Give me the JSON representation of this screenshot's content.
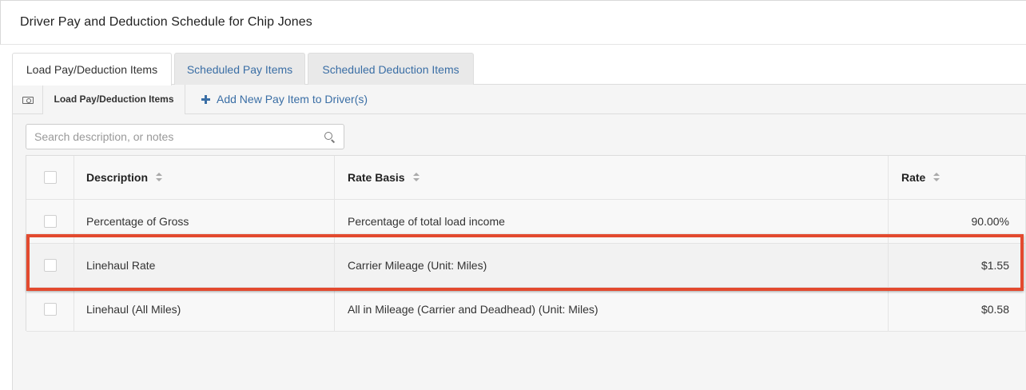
{
  "modal": {
    "title": "Driver Pay and Deduction Schedule for Chip Jones"
  },
  "tabs": [
    {
      "label": "Load Pay/Deduction Items",
      "active": true
    },
    {
      "label": "Scheduled Pay Items",
      "active": false
    },
    {
      "label": "Scheduled Deduction Items",
      "active": false
    }
  ],
  "toolbar": {
    "icon": "money-icon",
    "section_label": "Load Pay/Deduction Items",
    "add_label": "Add New Pay Item to Driver(s)"
  },
  "search": {
    "placeholder": "Search description, or notes"
  },
  "table": {
    "columns": [
      "Description",
      "Rate Basis",
      "Rate"
    ],
    "rows": [
      {
        "description": "Percentage of Gross",
        "rate_basis": "Percentage of total load income",
        "rate": "90.00%"
      },
      {
        "description": "Linehaul Rate",
        "rate_basis": "Carrier Mileage (Unit: Miles)",
        "rate": "$1.55"
      },
      {
        "description": "Linehaul (All Miles)",
        "rate_basis": "All in Mileage (Carrier and Deadhead) (Unit: Miles)",
        "rate": "$0.58"
      }
    ],
    "highlighted_row": 1
  },
  "colors": {
    "link": "#3a6ea5",
    "highlight": "#e34a2f"
  }
}
